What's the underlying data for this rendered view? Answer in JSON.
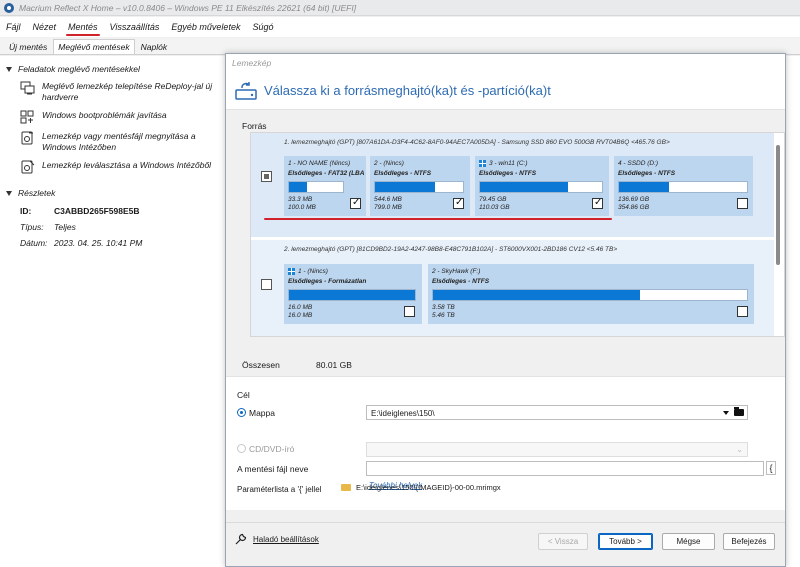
{
  "window": {
    "title": "Macrium Reflect X Home – v10.0.8406 – Windows PE 11 Elkészítés 22621 (64 bit)  [UEFI]"
  },
  "menu": [
    "Fájl",
    "Nézet",
    "Mentés",
    "Visszaállítás",
    "Egyéb műveletek",
    "Súgó"
  ],
  "tabs": [
    "Új mentés",
    "Meglévő mentések",
    "Naplók"
  ],
  "sidebar": {
    "tasks_header": "Feladatok meglévő mentésekkel",
    "tasks": [
      {
        "label": "Meglévő lemezkép telepítése ReDeploy-jal új hardverre",
        "icon": "redeploy-icon"
      },
      {
        "label": "Windows bootproblémák javítása",
        "icon": "boot-repair-icon"
      },
      {
        "label": "Lemezkép vagy mentésfájl megnyitása a Windows Intézőben",
        "icon": "open-image-icon"
      },
      {
        "label": "Lemezkép leválasztása a Windows Intézőből",
        "icon": "detach-image-icon"
      }
    ],
    "details_header": "Részletek",
    "id_label": "ID:",
    "id_value": "C3ABBD265F598E5B",
    "type_label": "Típus:",
    "type_value": "Teljes",
    "date_label": "Dátum:",
    "date_value": "2023. 04. 25. 10:41 PM"
  },
  "dialog": {
    "window_title": "Lemezkép",
    "heading": "Válassza ki a forrásmeghajtó(ka)t és -partíció(ka)t",
    "source_label": "Forrás",
    "disks": [
      {
        "title": "1. lemezmeghajtó (GPT) [807A61DA-D3F4-4C62-8AF0-94AEC7A005DA] - Samsung SSD 860 EVO 500GB RVT04B6Q  <465.76 GB>",
        "checked": "partial",
        "partitions": [
          {
            "name": "1 - NO NAME (Nincs)",
            "type": "Elsődleges - FAT32 (LBA",
            "used": "33.3 MB",
            "total": "100.0 MB",
            "fill": 0.33,
            "checked": true,
            "win": false
          },
          {
            "name": "2 -  (Nincs)",
            "type": "Elsődleges - NTFS",
            "used": "544.6 MB",
            "total": "799.0 MB",
            "fill": 0.68,
            "checked": true,
            "win": false
          },
          {
            "name": "3 - win11 (C:)",
            "type": "Elsődleges - NTFS",
            "used": "79.45 GB",
            "total": "110.03 GB",
            "fill": 0.72,
            "checked": true,
            "win": true
          },
          {
            "name": "4 - SSDD (D:)",
            "type": "Elsődleges - NTFS",
            "used": "136.69 GB",
            "total": "354.86 GB",
            "fill": 0.39,
            "checked": false,
            "win": false
          }
        ]
      },
      {
        "title": "2. lemezmeghajtó (GPT) [81CD9BD2-19A2-4247-98B8-E48C791B102A] - ST6000VX001-2BD186 CV12  <5.46 TB>",
        "checked": "none",
        "partitions": [
          {
            "name": "1 -  (Nincs)",
            "type": "Elsődleges - Formázatlan",
            "used": "16.0 MB",
            "total": "16.0 MB",
            "fill": 1.0,
            "checked": false,
            "win": true
          },
          {
            "name": "2 - SkyHawk (F:)",
            "type": "Elsődleges - NTFS",
            "used": "3.58 TB",
            "total": "5.46 TB",
            "fill": 0.66,
            "checked": false,
            "win": false
          }
        ]
      }
    ],
    "total_label": "Összesen",
    "total_value": "80.01 GB",
    "destination_label": "Cél",
    "folder_option": "Mappa",
    "folder_path": "E:\\ideiglenes\\150\\",
    "more_locations": "További helyek",
    "cd_option": "CD/DVD-író",
    "filename_label": "A mentési fájl neve",
    "filename_value": "",
    "brace_button": "{",
    "param_label": "Paraméterlista a '{' jellel",
    "param_value": "E:\\ideiglenes\\150\\{IMAGEID}-00-00.mrimgx",
    "advanced": "Haladó beállítások",
    "buttons": {
      "back": "< Vissza",
      "next": "Tovább >",
      "cancel": "Mégse",
      "finish": "Befejezés"
    }
  },
  "colors": {
    "accent": "#0a78d4",
    "title_blue": "#2d6bb3",
    "annotation_red": "#d0222a",
    "partition_bg": "#bdd6ef"
  }
}
